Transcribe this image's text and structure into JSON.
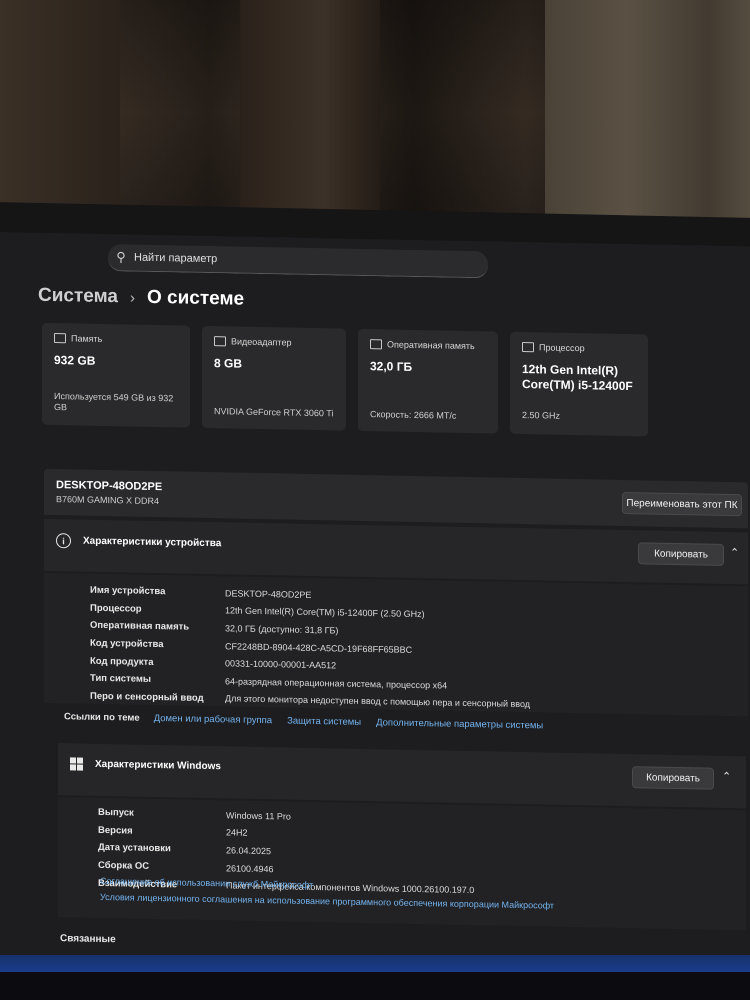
{
  "search": {
    "placeholder": "Найти параметр"
  },
  "breadcrumb": {
    "root": "Система",
    "separator": "›",
    "current": "О системе"
  },
  "cards": [
    {
      "title": "Память",
      "value": "932 GB",
      "detail": "Используется 549 GB из 932 GB"
    },
    {
      "title": "Видеоадаптер",
      "value": "8 GB",
      "detail": "NVIDIA GeForce RTX 3060 Ti"
    },
    {
      "title": "Оперативная память",
      "value": "32,0 ГБ",
      "detail": "Скорость: 2666 МТ/с"
    },
    {
      "title": "Процессор",
      "value": "12th Gen Intel(R) Core(TM) i5-12400F",
      "detail": "2.50 GHz"
    }
  ],
  "device": {
    "name": "DESKTOP-48OD2PE",
    "model": "B760M GAMING X DDR4",
    "rename_label": "Переименовать этот ПК"
  },
  "device_specs": {
    "title": "Характеристики устройства",
    "copy_label": "Копировать",
    "rows": [
      {
        "key": "Имя устройства",
        "value": "DESKTOP-48OD2PE"
      },
      {
        "key": "Процессор",
        "value": "12th Gen Intel(R) Core(TM) i5-12400F (2.50 GHz)"
      },
      {
        "key": "Оперативная память",
        "value": "32,0 ГБ (доступно: 31,8 ГБ)"
      },
      {
        "key": "Код устройства",
        "value": "CF2248BD-8904-428C-A5CD-19F68FF65BBC"
      },
      {
        "key": "Код продукта",
        "value": "00331-10000-00001-AA512"
      },
      {
        "key": "Тип системы",
        "value": "64-разрядная операционная система, процессор x64"
      },
      {
        "key": "Перо и сенсорный ввод",
        "value": "Для этого монитора недоступен ввод с помощью пера и сенсорный ввод"
      }
    ]
  },
  "related_links": {
    "label": "Ссылки по теме",
    "items": [
      "Домен или рабочая группа",
      "Защита системы",
      "Дополнительные параметры системы"
    ]
  },
  "windows_specs": {
    "title": "Характеристики Windows",
    "copy_label": "Копировать",
    "rows": [
      {
        "key": "Выпуск",
        "value": "Windows 11 Pro"
      },
      {
        "key": "Версия",
        "value": "24H2"
      },
      {
        "key": "Дата установки",
        "value": "26.04.2025"
      },
      {
        "key": "Сборка ОС",
        "value": "26100.4946"
      },
      {
        "key": "Взаимодействие",
        "value": "Пакет интерфейса компонентов Windows 1000.26100.197.0"
      }
    ],
    "links": [
      "Соглашение об использовании служб Майкрософт",
      "Условия лицензионного соглашения на использование программного обеспечения корпорации Майкрософт"
    ]
  },
  "related_title": "Связанные",
  "colors": {
    "accent_link": "#74b4f0",
    "panel": "#2a2a2c",
    "screen": "#1d1d1f"
  }
}
